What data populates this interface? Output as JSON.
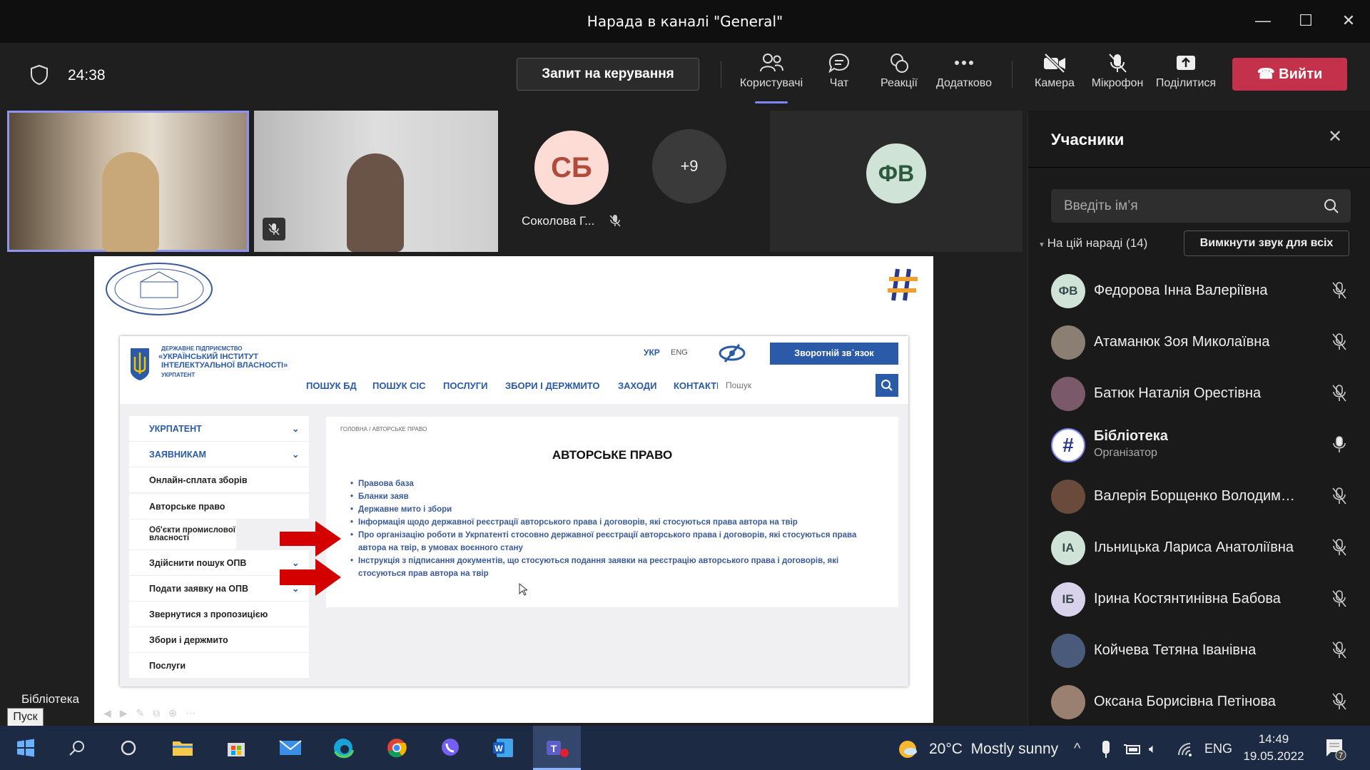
{
  "window": {
    "title": "Нарада в каналі \"General\""
  },
  "toolbar": {
    "timer": "24:38",
    "request_control": "Запит на керування",
    "tools": [
      {
        "label": "Користувачі",
        "icon": "people-icon"
      },
      {
        "label": "Чат",
        "icon": "chat-icon"
      },
      {
        "label": "Реакції",
        "icon": "reactions-icon"
      },
      {
        "label": "Додатково",
        "icon": "more-icon"
      },
      {
        "label": "Камера",
        "icon": "camera-off-icon"
      },
      {
        "label": "Мікрофон",
        "icon": "mic-off-icon"
      },
      {
        "label": "Поділитися",
        "icon": "share-icon"
      }
    ],
    "leave": "Вийти",
    "leave_color": "#c4314b"
  },
  "stage": {
    "tile_sb_initials": "СБ",
    "tile_sb_name": "Соколова Г...",
    "overflow": "+9",
    "tile_fv_initials": "ФВ",
    "presenter_label": "Бібліотека",
    "start_tooltip": "Пуск"
  },
  "website": {
    "org_line1": "ДЕРЖАВНЕ ПІДПРИЄМСТВО",
    "org_line2": "«УКРАЇНСЬКИЙ ІНСТИТУТ",
    "org_line3": "ІНТЕЛЕКТУАЛЬНОЇ ВЛАСНОСТІ»",
    "org_line4": "УКРПАТЕНТ",
    "lang_ukr": "УКР",
    "lang_eng": "ENG",
    "feedback": "Зворотній зв`язок",
    "nav": [
      "ПОШУК БД",
      "ПОШУК СІС",
      "ПОСЛУГИ",
      "ЗБОРИ І ДЕРЖМИТО",
      "ЗАХОДИ",
      "КОНТАКТИ"
    ],
    "search_placeholder": "Пошук",
    "sidebar": [
      "УКРПАТЕНТ",
      "ЗАЯВНИКАМ",
      "Онлайн-сплата зборів",
      "Авторське право",
      "Об'єкти промислової власності",
      "Здійснити пошук ОПВ",
      "Подати заявку на ОПВ",
      "Звернутися з пропозицією",
      "Збори і держмито",
      "Послуги"
    ],
    "breadcrumb": "ГОЛОВНА / АВТОРСЬКЕ ПРАВО",
    "heading": "АВТОРСЬКЕ ПРАВО",
    "links": [
      "Правова база",
      "Бланки заяв",
      "Державне мито і збори",
      "Інформація щодо державної реєстрації авторського права і договорів, які стосуються права автора на твір",
      "Про організацію роботи в Укрпатенті стосовно державної реєстрації авторського права і договорів, які стосуються права автора на твір, в умовах воєнного стану",
      "Інструкція з підписання документів, що стосуються подання заявки на реєстрацію авторського права і договорів, які стосуються прав автора на твір"
    ]
  },
  "participants": {
    "title": "Учасники",
    "search_placeholder": "Введіть ім’я",
    "section": "На цій нараді (14)",
    "mute_all": "Вимкнути звук для всіх",
    "list": [
      {
        "initials": "ФВ",
        "name": "Федорова Інна Валеріївна",
        "mic": "off",
        "color": "#cfe3d6"
      },
      {
        "initials": "",
        "name": "Атаманюк Зоя Миколаївна",
        "mic": "off",
        "color": "#8a7f72"
      },
      {
        "initials": "",
        "name": "Батюк Наталія Орестівна",
        "mic": "off",
        "color": "#7a5a6a"
      },
      {
        "initials": "#",
        "name": "Бібліотека",
        "role": "Організатор",
        "mic": "on",
        "color": "#ffffff"
      },
      {
        "initials": "",
        "name": "Валерія Борщенко Володимирівна",
        "mic": "off",
        "color": "#6a4a3a"
      },
      {
        "initials": "ІА",
        "name": "Ільницька Лариса Анатоліївна",
        "mic": "off",
        "color": "#cfe3d6"
      },
      {
        "initials": "ІБ",
        "name": "Ірина Костянтинівна Бабова",
        "mic": "off",
        "color": "#d8d3ea"
      },
      {
        "initials": "",
        "name": "Койчева Тетяна Іванівна",
        "mic": "off",
        "color": "#4a5a7a"
      },
      {
        "initials": "",
        "name": "Оксана Борисівна Петінова",
        "mic": "off",
        "color": "#9a8070"
      }
    ]
  },
  "taskbar": {
    "weather": "20°C  Mostly sunny",
    "lang": "ENG",
    "time": "14:49",
    "date": "19.05.2022",
    "notifications": "7"
  }
}
